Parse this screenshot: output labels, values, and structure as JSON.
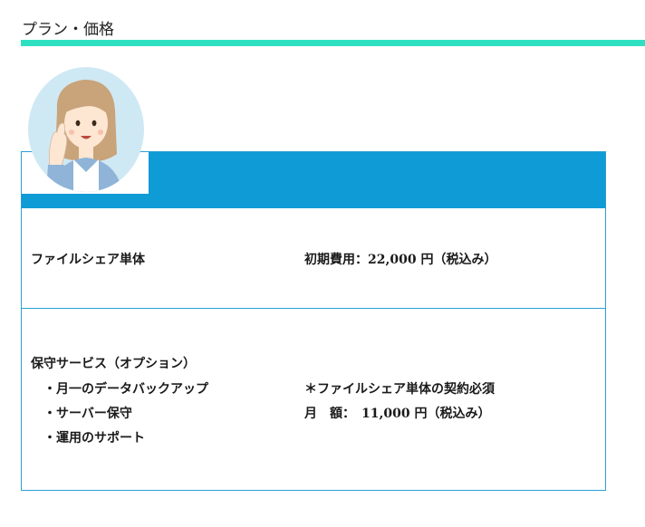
{
  "section": {
    "title": "プラン・価格"
  },
  "colors": {
    "rule": "#2ee0c0",
    "header": "#0f9bd6",
    "border": "#2a9fd3"
  },
  "plans": [
    {
      "name": "ファイルシェア単体",
      "price": "初期費用：22,000 円（税込み）"
    },
    {
      "name": "保守サービス（オプション）",
      "features": [
        "・月一のデータバックアップ",
        "・サーバー保守",
        "・運用のサポート"
      ],
      "note": "＊ファイルシェア単体の契約必須",
      "price": "月　額：　11,000  円（税込み）"
    }
  ]
}
